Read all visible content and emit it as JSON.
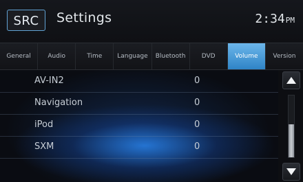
{
  "header": {
    "src_label": "SRC",
    "title": "Settings",
    "clock_time": "2:34",
    "clock_ampm": "PM"
  },
  "tabs": [
    {
      "label": "General",
      "active": false
    },
    {
      "label": "Audio",
      "active": false
    },
    {
      "label": "Time",
      "active": false
    },
    {
      "label": "Language",
      "active": false
    },
    {
      "label": "Bluetooth",
      "active": false
    },
    {
      "label": "DVD",
      "active": false
    },
    {
      "label": "Volume",
      "active": true
    },
    {
      "label": "Version",
      "active": false
    }
  ],
  "volume_list": [
    {
      "name": "AV-IN2",
      "value": "0"
    },
    {
      "name": "Navigation",
      "value": "0"
    },
    {
      "name": "iPod",
      "value": "0"
    },
    {
      "name": "SXM",
      "value": "0"
    }
  ],
  "scrollbar": {
    "up_icon": "arrow-up-icon",
    "down_icon": "arrow-down-icon",
    "position_fraction": 0.5
  },
  "colors": {
    "accent": "#4a9ee0",
    "background": "#0b0c10"
  }
}
